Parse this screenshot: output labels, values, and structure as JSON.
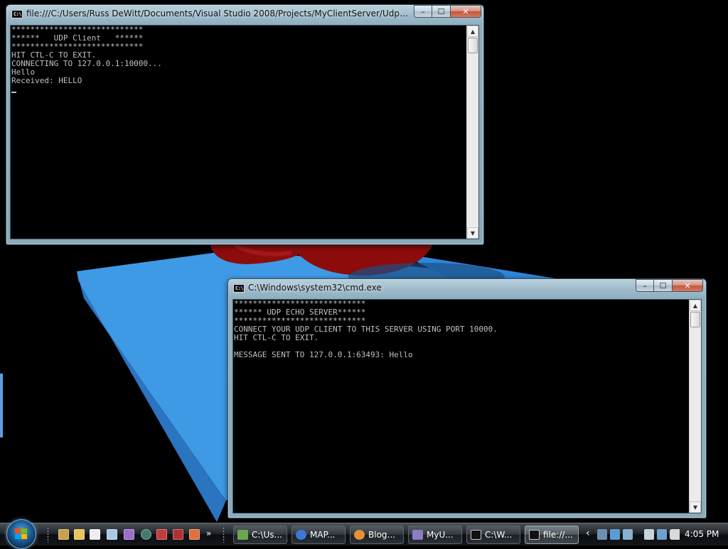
{
  "client_window": {
    "title": "file:///C:/Users/Russ DeWitt/Documents/Visual Studio 2008/Projects/MyClientServer/UdpClientCons...",
    "lines": [
      "****************************",
      "******   UDP Client   ******",
      "****************************",
      "HIT CTL-C TO EXIT.",
      "CONNECTING TO 127.0.0.1:10000...",
      "Hello",
      "Received: HELLO"
    ]
  },
  "server_window": {
    "title": "C:\\Windows\\system32\\cmd.exe",
    "lines": [
      "****************************",
      "****** UDP ECHO SERVER******",
      "****************************",
      "CONNECT YOUR UDP CLIENT TO THIS SERVER USING PORT 10000.",
      "HIT CTL-C TO EXIT.",
      "",
      "MESSAGE SENT TO 127.0.0.1:63493: Hello"
    ]
  },
  "window_controls": {
    "minimize": "–",
    "maximize": "☐",
    "close": "✕"
  },
  "scrollbar_arrows": {
    "up": "▲",
    "down": "▼"
  },
  "console_icon_text": "C:\\",
  "taskbar": {
    "quick_launch_more": "»",
    "buttons": [
      {
        "label": "C:\\Us...",
        "icon": "folder-icon",
        "color": "#6aa84f"
      },
      {
        "label": "MAP...",
        "icon": "app-g-icon",
        "color": "#3c78d8"
      },
      {
        "label": "Blog...",
        "icon": "firefox-icon",
        "color": "#e69138"
      },
      {
        "label": "MyU...",
        "icon": "visual-studio-icon",
        "color": "#8e7cc3"
      },
      {
        "label": "C:\\W...",
        "icon": "console-icon",
        "color": "#111111"
      },
      {
        "label": "file://...",
        "icon": "console-icon",
        "color": "#111111"
      }
    ],
    "tray_expand": "‹",
    "clock": "4:05 PM"
  }
}
